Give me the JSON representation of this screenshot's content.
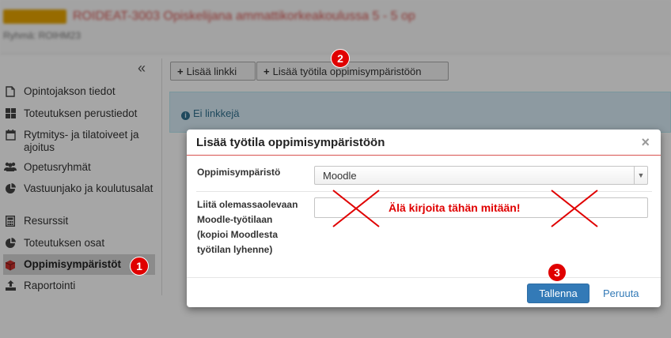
{
  "header": {
    "title": "ROIDEAT-3003 Opiskelijana ammattikorkeakoulussa 5 - 5 op",
    "subtitle": "Ryhmä: ROIHM23"
  },
  "sidebar": {
    "collapse_glyph": "«",
    "items": [
      {
        "label": "Opintojakson tiedot",
        "icon": "document-icon"
      },
      {
        "label": "Toteutuksen perustiedot",
        "icon": "grid-icon"
      },
      {
        "label": "Rytmitys- ja tilatoiveet ja ajoitus",
        "icon": "calendar-icon"
      },
      {
        "label": "Opetusryhmät",
        "icon": "users-icon"
      },
      {
        "label": "Vastuunjako ja koulutusalat",
        "icon": "pie-chart-icon"
      },
      {
        "label": "Resurssit",
        "icon": "calculator-icon"
      },
      {
        "label": "Toteutuksen osat",
        "icon": "pie-chart-icon"
      },
      {
        "label": "Oppimisympäristöt",
        "icon": "cube-icon",
        "active": true
      },
      {
        "label": "Raportointi",
        "icon": "upload-icon"
      }
    ]
  },
  "toolbar": {
    "add_link_label": "Lisää linkki",
    "add_workspace_label": "Lisää työtila oppimisympäristöön"
  },
  "info": {
    "text": "Ei linkkejä"
  },
  "modal": {
    "title": "Lisää työtila oppimisympäristöön",
    "close_glyph": "×",
    "env_label": "Oppimisympäristö",
    "env_value": "Moodle",
    "link_label_lines": [
      "Liitä olemassaolevaan",
      "Moodle-työtilaan",
      "(kopioi Moodlesta",
      "työtilan lyhenne)"
    ],
    "link_value": "",
    "warning": "Älä kirjoita tähän mitään!",
    "save_label": "Tallenna",
    "cancel_label": "Peruuta"
  },
  "badges": [
    "1",
    "2",
    "3"
  ],
  "colors": {
    "annotation_red": "#e00000",
    "primary": "#337ab7",
    "header_accent": "#d9534f"
  }
}
